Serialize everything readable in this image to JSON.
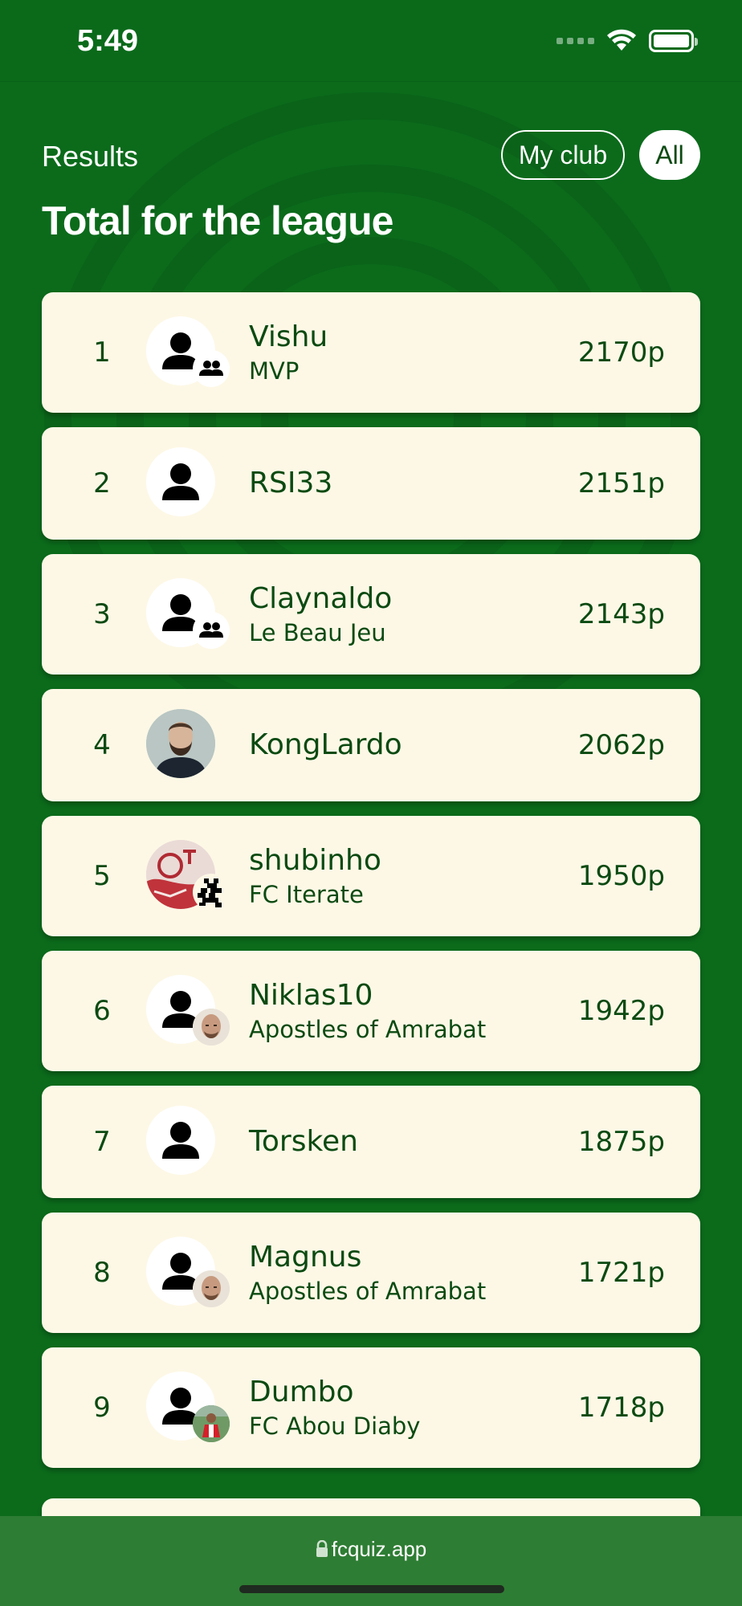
{
  "status_bar": {
    "time": "5:49"
  },
  "header": {
    "section_label": "Results",
    "filters": [
      {
        "label": "My club",
        "selected": false
      },
      {
        "label": "All",
        "selected": true
      }
    ],
    "title": "Total for the league"
  },
  "leaderboard": [
    {
      "rank": "1",
      "name": "Vishu",
      "club": "MVP",
      "points": "2170p",
      "avatar": "default-user-icon",
      "badge": "group-icon"
    },
    {
      "rank": "2",
      "name": "RSI33",
      "club": "",
      "points": "2151p",
      "avatar": "default-user-icon",
      "badge": ""
    },
    {
      "rank": "3",
      "name": "Claynaldo",
      "club": "Le Beau Jeu",
      "points": "2143p",
      "avatar": "default-user-icon",
      "badge": "group-icon"
    },
    {
      "rank": "4",
      "name": "KongLardo",
      "club": "",
      "points": "2062p",
      "avatar": "bearded-man-photo",
      "badge": ""
    },
    {
      "rank": "5",
      "name": "shubinho",
      "club": "FC Iterate",
      "points": "1950p",
      "avatar": "red-crest-photo",
      "badge": "pixel-art-badge"
    },
    {
      "rank": "6",
      "name": "Niklas10",
      "club": "Apostles of Amrabat",
      "points": "1942p",
      "avatar": "default-user-icon",
      "badge": "bald-player-photo"
    },
    {
      "rank": "7",
      "name": "Torsken",
      "club": "",
      "points": "1875p",
      "avatar": "default-user-icon",
      "badge": ""
    },
    {
      "rank": "8",
      "name": "Magnus",
      "club": "Apostles of Amrabat",
      "points": "1721p",
      "avatar": "default-user-icon",
      "badge": "bald-player-photo"
    },
    {
      "rank": "9",
      "name": "Dumbo",
      "club": "FC Abou Diaby",
      "points": "1718p",
      "avatar": "default-user-icon",
      "badge": "football-player-photo"
    }
  ],
  "browser": {
    "url": "fcquiz.app"
  },
  "colors": {
    "background": "#0b6b1b",
    "card": "#fdf8e6",
    "text": "#0b4a12",
    "url_bar": "#2e7d34"
  }
}
